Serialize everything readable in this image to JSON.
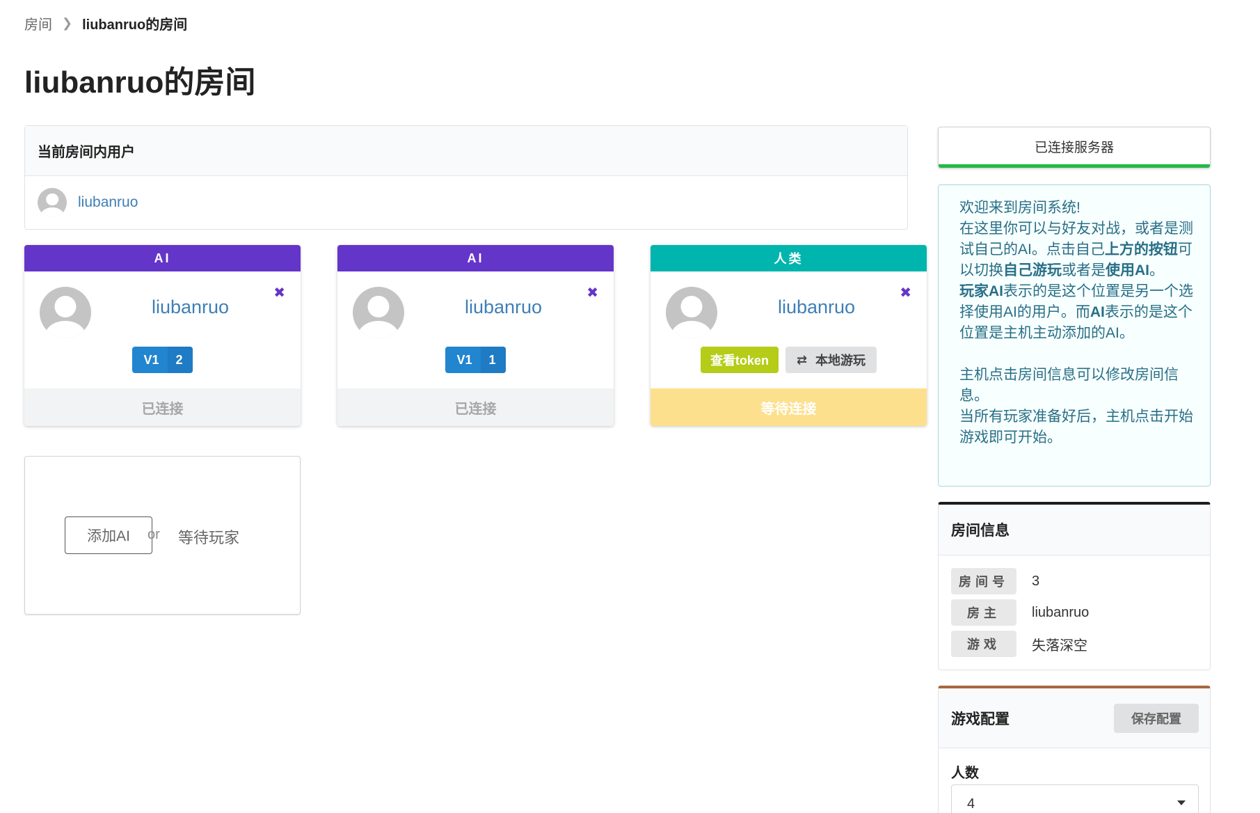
{
  "breadcrumb": {
    "parent": "房间",
    "current": "liubanruo的房间"
  },
  "page_title": "liubanruo的房间",
  "users_box": {
    "title": "当前房间内用户",
    "users": [
      "liubanruo"
    ]
  },
  "seats": [
    {
      "type": "AI",
      "name": "liubanruo",
      "version": "V1",
      "version_num": "2",
      "status": "已连接",
      "head_color": "#6435c9"
    },
    {
      "type": "AI",
      "name": "liubanruo",
      "version": "V1",
      "version_num": "1",
      "status": "已连接",
      "head_color": "#6435c9"
    },
    {
      "type": "人类",
      "name": "liubanruo",
      "token_btn": "查看token",
      "local_btn": "本地游玩",
      "status": "等待连接",
      "head_color": "#00b5ad"
    }
  ],
  "empty_seat": {
    "add_ai": "添加AI",
    "or": "or",
    "waiting": "等待玩家"
  },
  "server_status": "已连接服务器",
  "info_message": {
    "p1": "欢迎来到房间系统!",
    "p2a": "在这里你可以与好友对战，或者是测试自己的AI。点击自己",
    "p2b": "上方的按钮",
    "p2c": "可以切换",
    "p2d": "自己游玩",
    "p2e": "或者是",
    "p2f": "使用AI",
    "p2g": "。",
    "p3a": "玩家AI",
    "p3b": "表示的是这个位置是另一个选择使用AI的用户。而",
    "p3c": "AI",
    "p3d": "表示的是这个位置是主机主动添加的AI。",
    "p4": "主机点击房间信息可以修改房间信息。",
    "p5": "当所有玩家准备好后，主机点击开始游戏即可开始。"
  },
  "room_info": {
    "title": "房间信息",
    "room_no_label": "房间号",
    "room_no": "3",
    "host_label": "房主",
    "host": "liubanruo",
    "game_label": "游戏",
    "game": "失落深空"
  },
  "game_config": {
    "title": "游戏配置",
    "save_label": "保存配置",
    "players_label": "人数",
    "players_value": "4"
  }
}
